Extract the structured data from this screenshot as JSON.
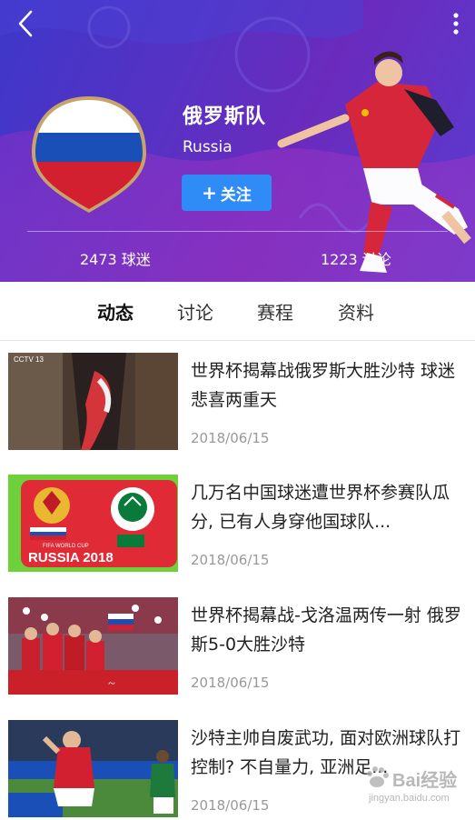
{
  "header": {
    "team_name": "俄罗斯队",
    "team_name_en": "Russia",
    "follow_label": "关注",
    "follow_icon": "plus-icon",
    "back_icon": "chevron-left-icon",
    "more_icon": "more-vertical-icon",
    "stats": {
      "fans": "2473 球迷",
      "discussions": "1223 讨论"
    },
    "colors": {
      "accent": "#2f8cf6",
      "bg": "#5632c4"
    }
  },
  "tabs": [
    {
      "label": "动态",
      "active": true
    },
    {
      "label": "讨论",
      "active": false
    },
    {
      "label": "赛程",
      "active": false
    },
    {
      "label": "资料",
      "active": false
    }
  ],
  "news": [
    {
      "title": "世界杯揭幕战俄罗斯大胜沙特 球迷悲喜两重天",
      "date": "2018/06/15",
      "thumb_label": "CCTV 13"
    },
    {
      "title": "几万名中国球迷遭世界杯参赛队瓜分, 已有人身穿他国球队...",
      "date": "2018/06/15",
      "thumb_label": "RUSSIA 2018",
      "thumb_sub": "FIFA WORLD CUP"
    },
    {
      "title": "世界杯揭幕战-戈洛温两传一射 俄罗斯5-0大胜沙特",
      "date": "2018/06/15"
    },
    {
      "title": "沙特主帅自废武功, 面对欧洲球队打控制? 不自量力, 亚洲足...",
      "date": "2018/06/15"
    }
  ],
  "watermark": {
    "text": "Bai经验",
    "sub": "jingyan.baidu.com"
  }
}
